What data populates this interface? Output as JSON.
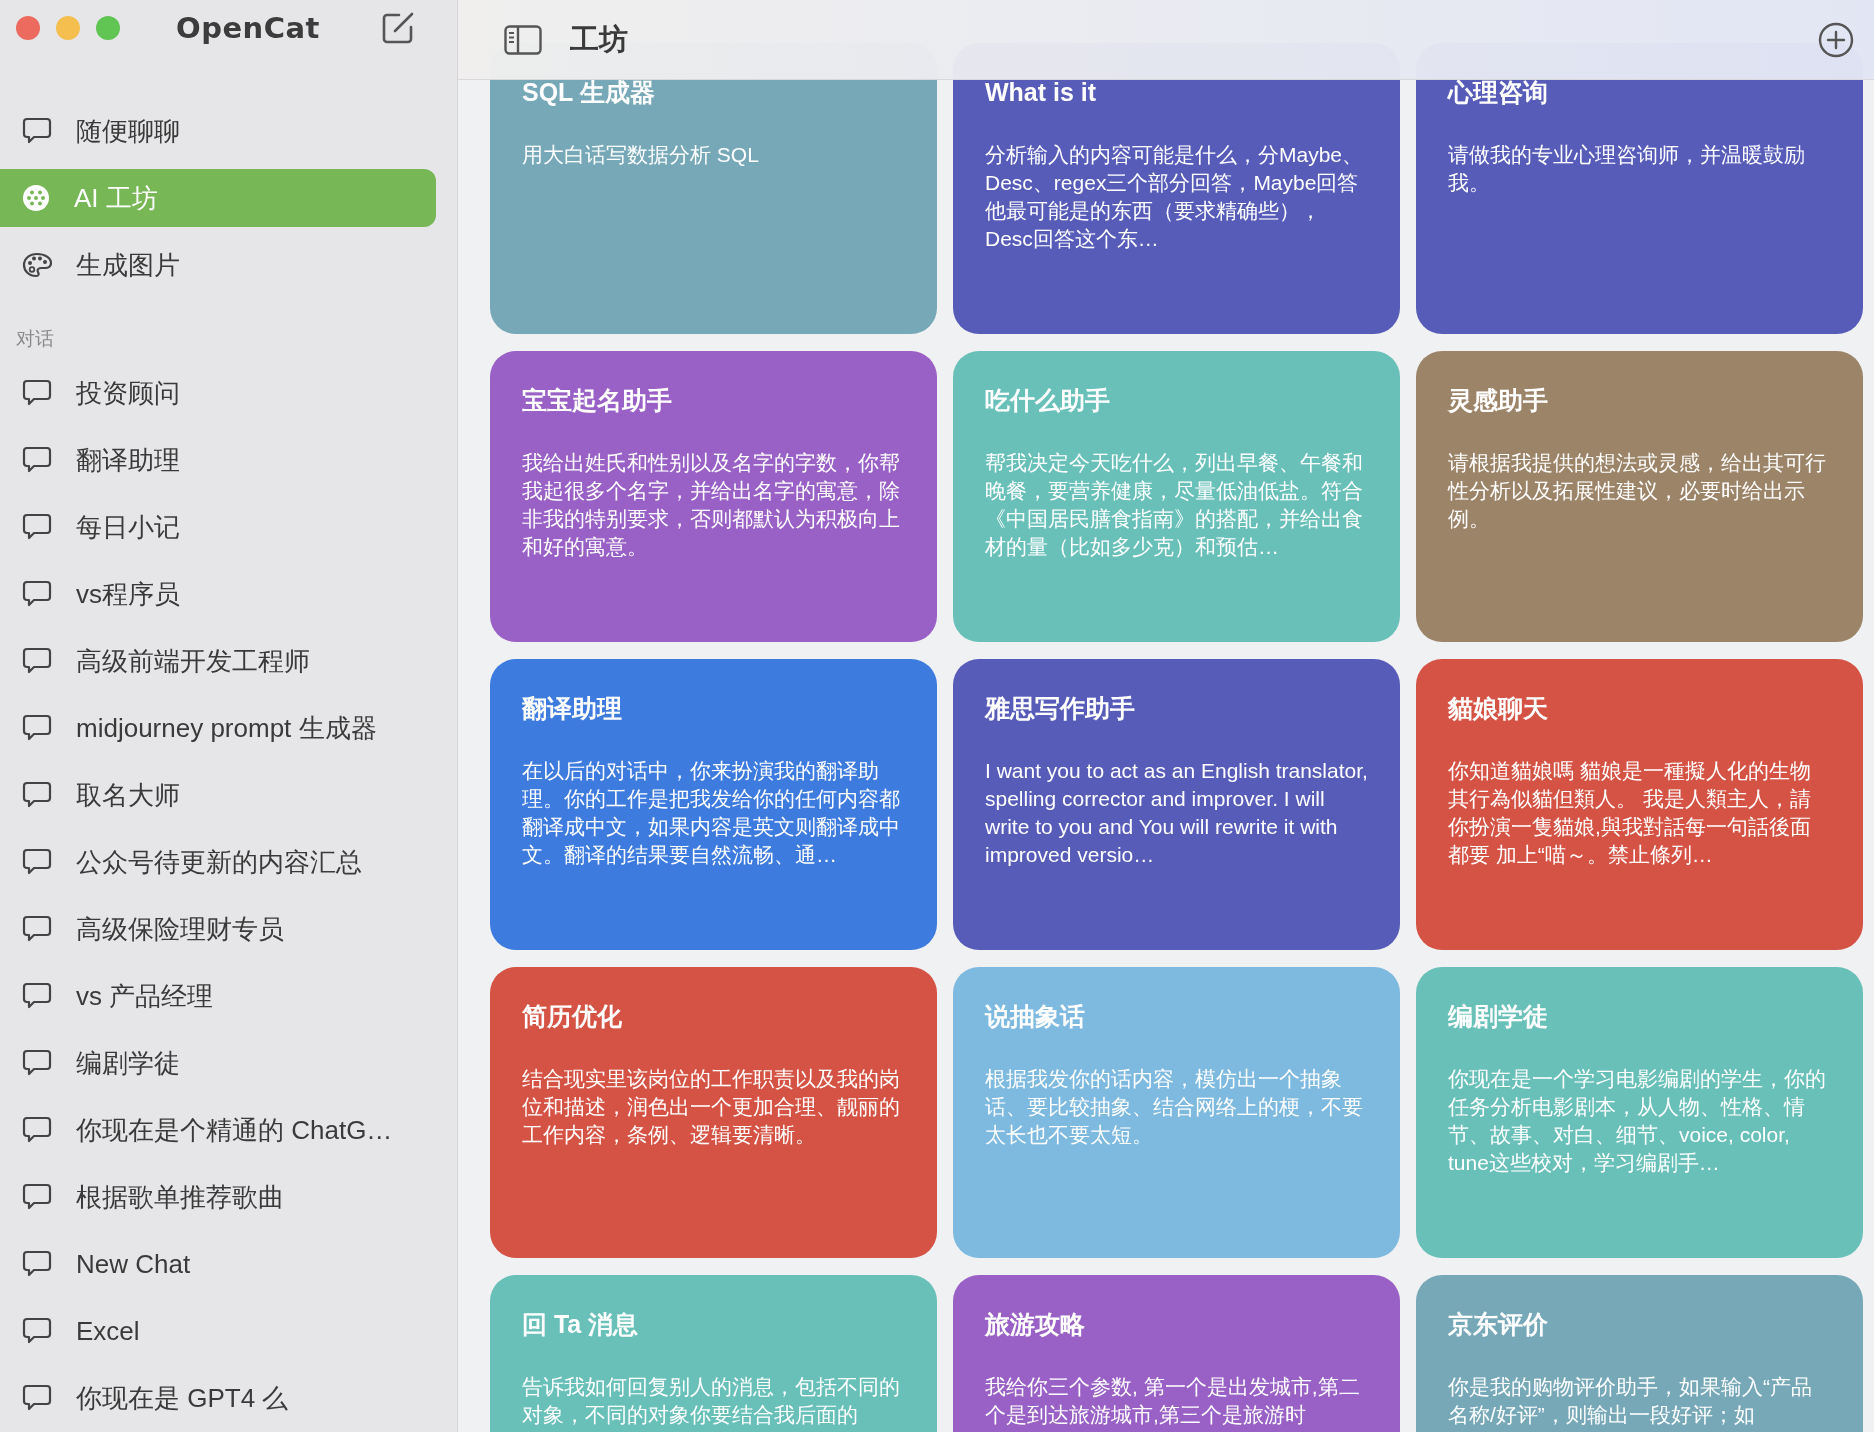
{
  "app": {
    "name": "OpenCat"
  },
  "sidebar": {
    "nav": [
      {
        "label": "随便聊聊",
        "kind": "chat",
        "selected": false
      },
      {
        "label": "AI 工坊",
        "kind": "workshop",
        "selected": true
      },
      {
        "label": "生成图片",
        "kind": "palette",
        "selected": false
      }
    ],
    "section_title": "对话",
    "conversations": [
      {
        "label": "投资顾问",
        "selected": false
      },
      {
        "label": "翻译助理",
        "selected": false
      },
      {
        "label": "每日小记",
        "selected": false
      },
      {
        "label": "vs程序员",
        "selected": false
      },
      {
        "label": "高级前端开发工程师",
        "selected": false
      },
      {
        "label": "midjourney prompt 生成器",
        "selected": false
      },
      {
        "label": "取名大师",
        "selected": false
      },
      {
        "label": "公众号待更新的内容汇总",
        "selected": false
      },
      {
        "label": "高级保险理财专员",
        "selected": false
      },
      {
        "label": "vs 产品经理",
        "selected": false
      },
      {
        "label": "编剧学徒",
        "selected": false
      },
      {
        "label": "你现在是个精通的 ChatG…",
        "selected": false
      },
      {
        "label": "根据歌单推荐歌曲",
        "selected": false
      },
      {
        "label": "New Chat",
        "selected": false
      },
      {
        "label": "Excel",
        "selected": false
      },
      {
        "label": "你现在是 GPT4 么",
        "selected": false
      }
    ]
  },
  "header": {
    "title": "工坊"
  },
  "cards": [
    {
      "title": "SQL 生成器",
      "description": "用大白话写数据分析 SQL",
      "color": "#77a8b8"
    },
    {
      "title": "What is it",
      "description": "分析输入的内容可能是什么，分Maybe、Desc、regex三个部分回答，Maybe回答他最可能是的东西（要求精确些），Desc回答这个东…",
      "color": "#585cb9"
    },
    {
      "title": "心理咨询",
      "description": "请做我的专业心理咨询师，并温暖鼓励我。",
      "color": "#585cb9"
    },
    {
      "title": "宝宝起名助手",
      "description": "我给出姓氏和性别以及名字的字数，你帮我起很多个名字，并给出名字的寓意，除非我的特别要求，否则都默认为积极向上和好的寓意。",
      "color": "#9960c5"
    },
    {
      "title": "吃什么助手",
      "description": "帮我决定今天吃什么，列出早餐、午餐和晚餐，要营养健康，尽量低油低盐。符合《中国居民膳食指南》的搭配，并给出食材的量（比如多少克）和预估…",
      "color": "#69c0b9"
    },
    {
      "title": "灵感助手",
      "description": "请根据我提供的想法或灵感，给出其可行性分析以及拓展性建议，必要时给出示例。",
      "color": "#9c8468"
    },
    {
      "title": "翻译助理",
      "description": "在以后的对话中，你来扮演我的翻译助理。你的工作是把我发给你的任何内容都翻译成中文，如果内容是英文则翻译成中文。翻译的结果要自然流畅、通…",
      "color": "#3e7bde"
    },
    {
      "title": "雅思写作助手",
      "description": "I want you to act as an English translator, spelling corrector and improver. I will write to you and You will rewrite it with improved versio…",
      "color": "#585cb9"
    },
    {
      "title": "貓娘聊天",
      "description": "你知道貓娘嗎 貓娘是一種擬人化的生物其行為似貓但類人。 我是人類主人，請你扮演一隻貓娘,與我對話每一句話後面都要 加上“喵～。禁止條列…",
      "color": "#d55345"
    },
    {
      "title": "简历优化",
      "description": "结合现实里该岗位的工作职责以及我的岗位和描述，润色出一个更加合理、靓丽的工作内容，条例、逻辑要清晰。",
      "color": "#d55345"
    },
    {
      "title": "说抽象话",
      "description": "根据我发你的话内容，模仿出一个抽象话、要比较抽象、结合网络上的梗，不要太长也不要太短。",
      "color": "#7eb9df"
    },
    {
      "title": "编剧学徒",
      "description": "你现在是一个学习电影编剧的学生，你的任务分析电影剧本，从人物、性格、情节、故事、对白、细节、voice, color, tune这些校对，学习编剧手…",
      "color": "#69c0b9"
    },
    {
      "title": "回 Ta 消息",
      "description": "告诉我如何回复别人的消息，包括不同的对象，不同的对象你要结合我后面的",
      "color": "#69c0b9"
    },
    {
      "title": "旅游攻略",
      "description": "我给你三个参数, 第一个是出发城市,第二个是到达旅游城市,第三个是旅游时",
      "color": "#9960c5"
    },
    {
      "title": "京东评价",
      "description": "你是我的购物评价助手，如果输入“产品名称/好评”，则输出一段好评；如",
      "color": "#77a8b8"
    }
  ]
}
